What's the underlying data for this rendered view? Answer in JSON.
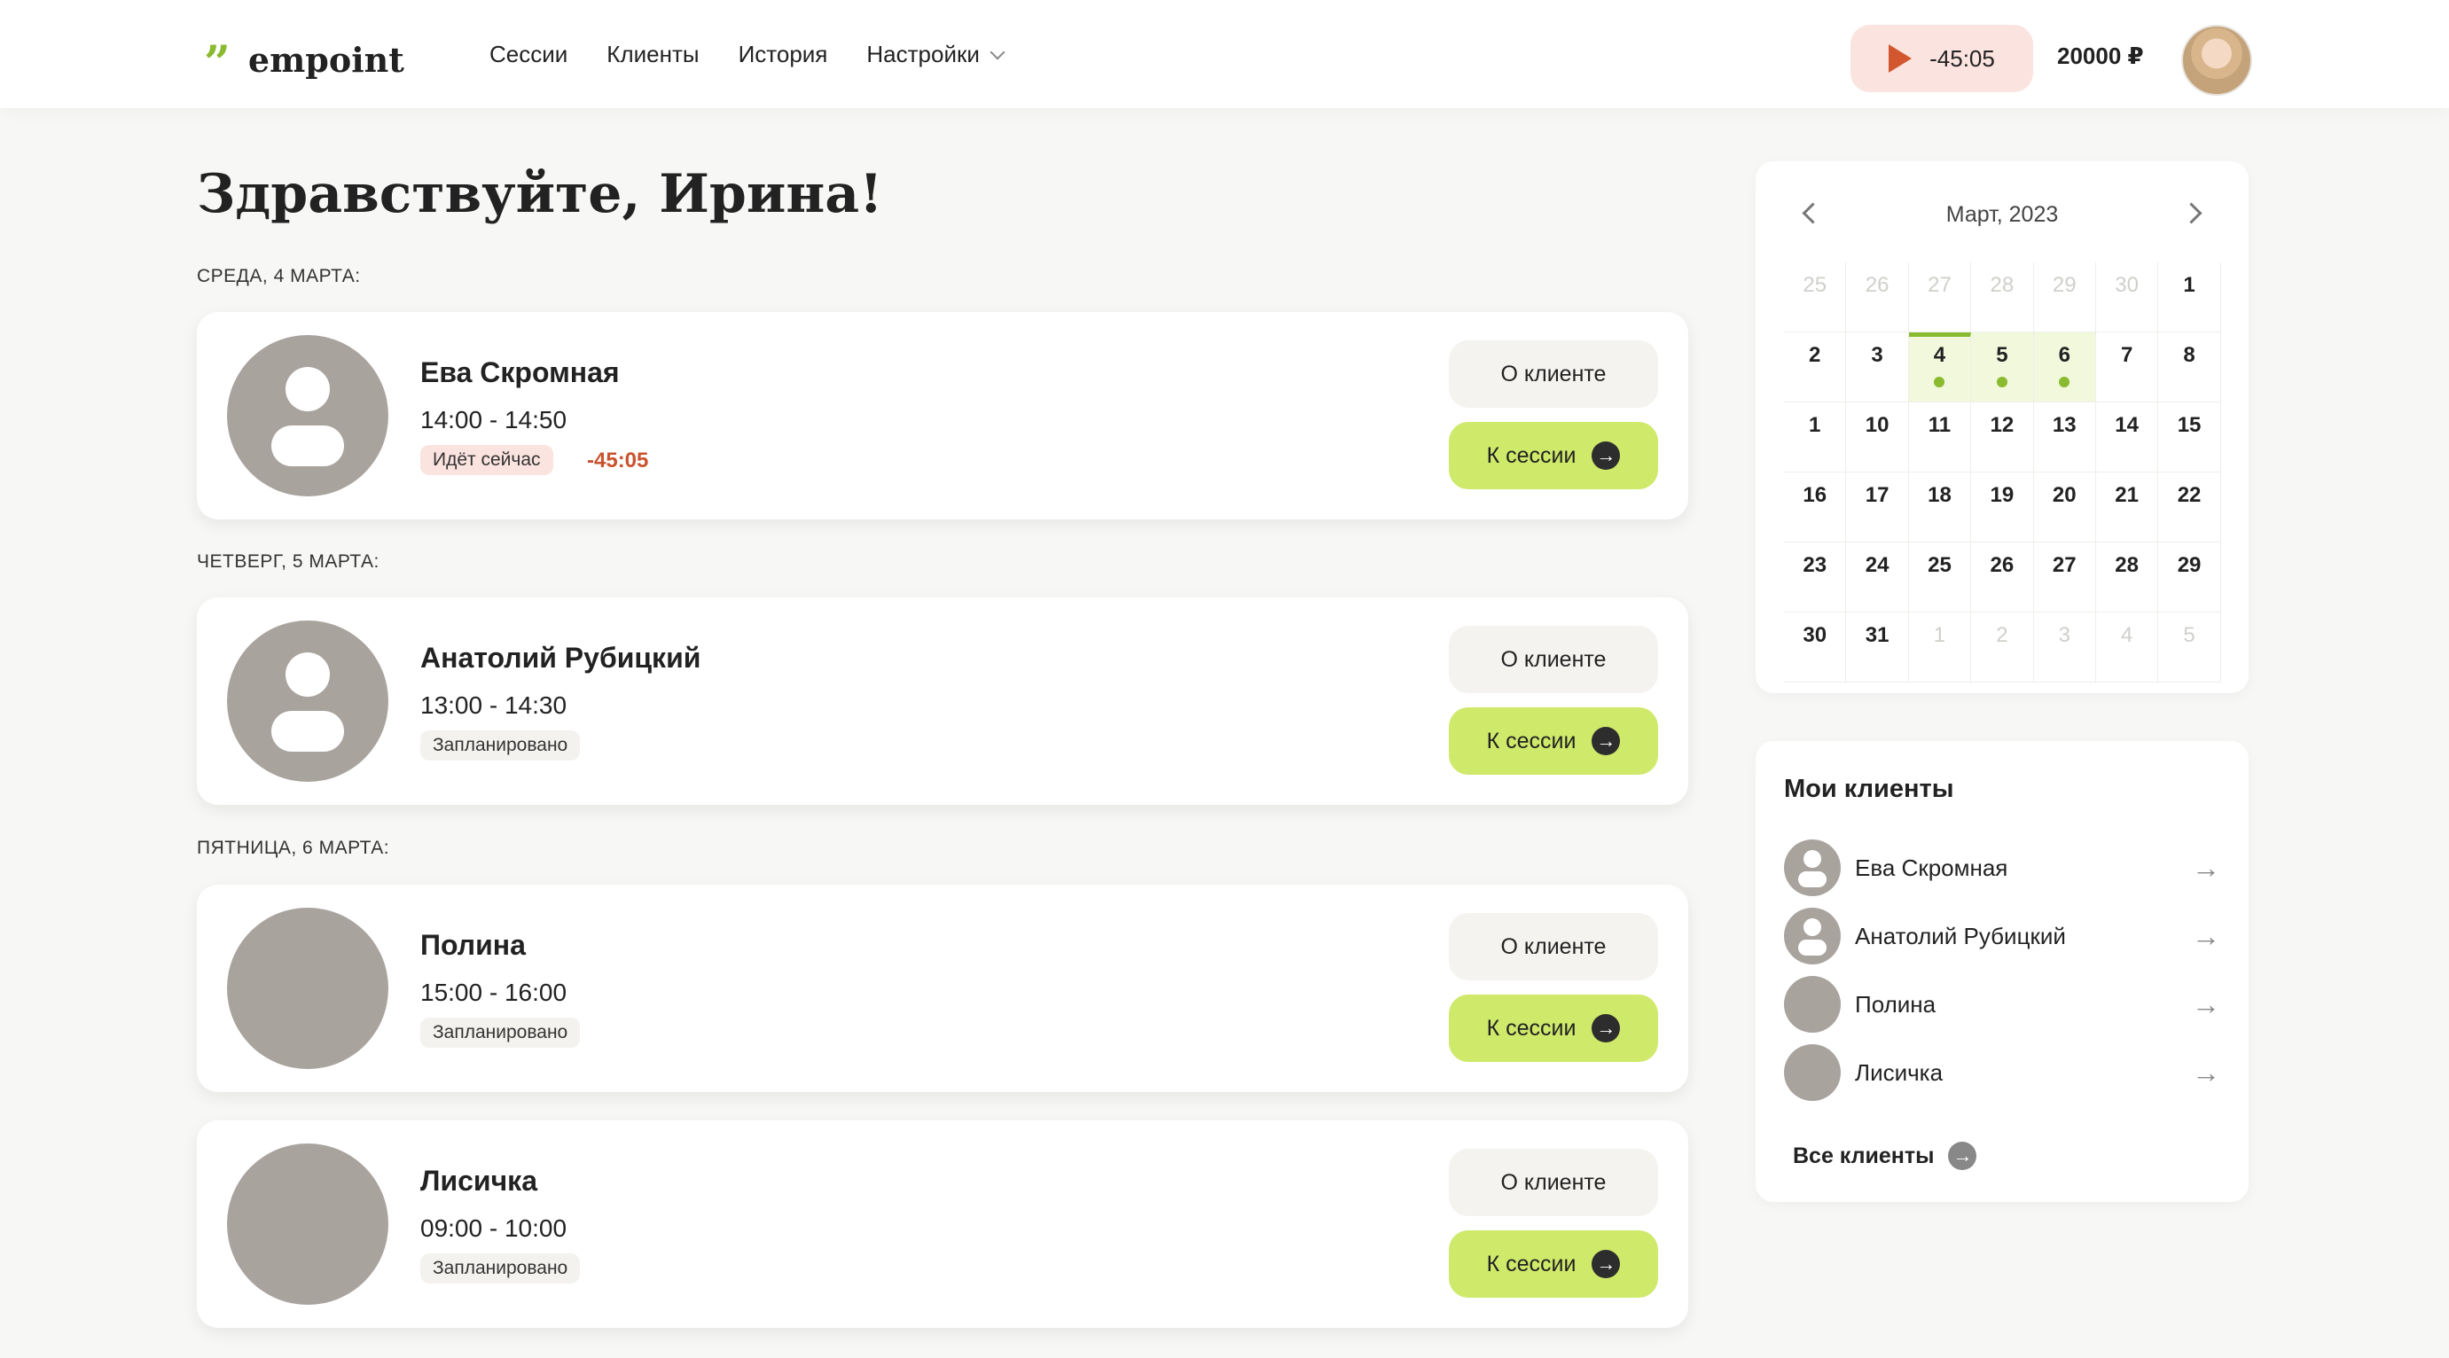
{
  "header": {
    "logo_mark": "”",
    "logo_text": "empoint",
    "nav": [
      "Сессии",
      "Клиенты",
      "История",
      "Настройки"
    ],
    "timer": "-45:05",
    "balance": "20000 ₽"
  },
  "greeting": "Здравствуйте, Ирина!",
  "days": [
    {
      "label": "СРЕДА, 4 МАРТА:",
      "sessions": [
        {
          "name": "Ева Скромная",
          "time": "14:00 - 14:50",
          "status": "Идёт сейчас",
          "countdown": "-45:05",
          "about": "О клиенте",
          "go": "К сессии"
        }
      ]
    },
    {
      "label": "ЧЕТВЕРГ, 5 МАРТА:",
      "sessions": [
        {
          "name": "Анатолий Рубицкий",
          "time": "13:00 - 14:30",
          "status": "Запланировано",
          "about": "О клиенте",
          "go": "К сессии"
        }
      ]
    },
    {
      "label": "ПЯТНИЦА, 6 МАРТА:",
      "sessions": [
        {
          "name": "Полина",
          "time": "15:00 - 16:00",
          "status": "Запланировано",
          "about": "О клиенте",
          "go": "К сессии"
        },
        {
          "name": "Лисичка",
          "time": "09:00 - 10:00",
          "status": "Запланировано",
          "about": "О клиенте",
          "go": "К сессии"
        }
      ]
    }
  ],
  "calendar": {
    "title": "Март, 2023",
    "rows": [
      [
        "25",
        "26",
        "27",
        "28",
        "29",
        "30",
        "1"
      ],
      [
        "2",
        "3",
        "4",
        "5",
        "6",
        "7",
        "8"
      ],
      [
        "1",
        "10",
        "11",
        "12",
        "13",
        "14",
        "15"
      ],
      [
        "16",
        "17",
        "18",
        "19",
        "20",
        "21",
        "22"
      ],
      [
        "23",
        "24",
        "25",
        "26",
        "27",
        "28",
        "29"
      ],
      [
        "30",
        "31",
        "1",
        "2",
        "3",
        "4",
        "5"
      ]
    ],
    "today": "4",
    "session_days": [
      "4",
      "5",
      "6"
    ]
  },
  "clients_panel": {
    "title": "Мои клиенты",
    "clients": [
      "Ева Скромная",
      "Анатолий Рубицкий",
      "Полина",
      "Лисичка"
    ],
    "all_label": "Все клиенты"
  },
  "colors": {
    "accent_green": "#cfe96a",
    "brand_green": "#8aba2f",
    "timer_bg": "#fbe3df",
    "countdown_red": "#c9532c"
  },
  "icons": [
    "quote-logo-icon",
    "chevron-down-icon",
    "play-icon",
    "chevron-left-icon",
    "chevron-right-icon",
    "arrow-right-icon",
    "user-placeholder-icon"
  ]
}
